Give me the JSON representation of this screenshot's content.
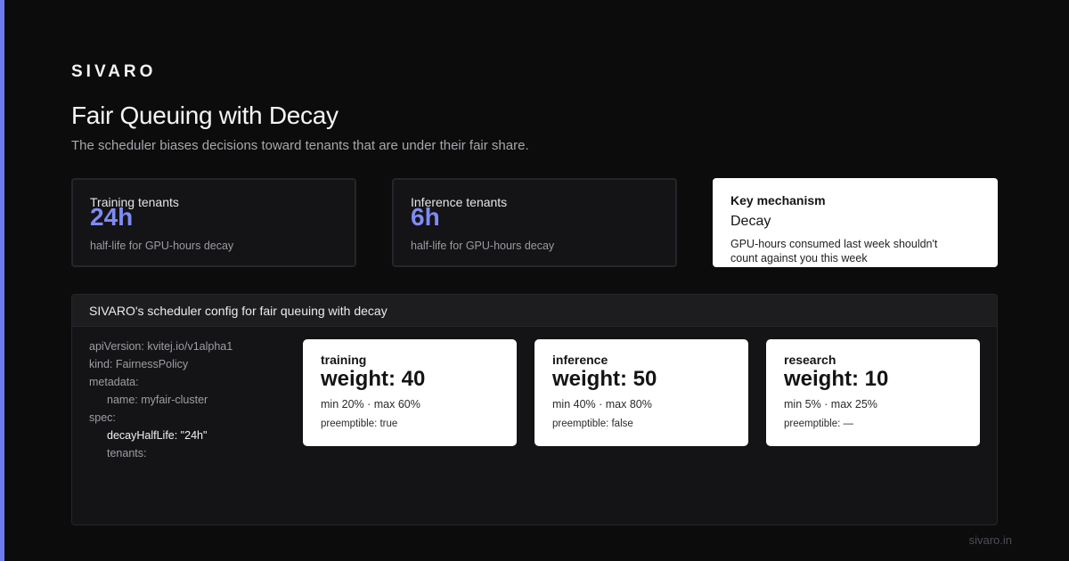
{
  "brand": "SIVARO",
  "title": "Fair Queuing with Decay",
  "subtitle": "The scheduler biases decisions toward tenants that are under their fair share.",
  "stats": [
    {
      "label": "Training tenants",
      "value": "24h",
      "caption": "half-life for GPU-hours decay"
    },
    {
      "label": "Inference tenants",
      "value": "6h",
      "caption": "half-life for GPU-hours decay"
    }
  ],
  "mechanism": {
    "label": "Key mechanism",
    "value": "Decay",
    "description": "GPU-hours consumed last week shouldn't count against you this week"
  },
  "config": {
    "header": "SIVARO's scheduler config for fair queuing with decay",
    "code_lines": [
      "apiVersion: kvitej.io/v1alpha1",
      "kind: FairnessPolicy",
      "metadata:",
      "name: myfair-cluster",
      "spec:",
      "decayHalfLife: \"24h\"",
      "tenants:"
    ],
    "tenants": [
      {
        "name": "training",
        "weight": "weight: 40",
        "limits": "min 20% · max 60%",
        "preemptible": "preemptible: true"
      },
      {
        "name": "inference",
        "weight": "weight: 50",
        "limits": "min 40% · max 80%",
        "preemptible": "preemptible: false"
      },
      {
        "name": "research",
        "weight": "weight: 10",
        "limits": "min 5% · max 25%",
        "preemptible": "preemptible: —"
      }
    ]
  },
  "footer": "sivaro.in",
  "colors": {
    "accent": "#6f7cf0",
    "stat_value": "#7f8bf3",
    "background": "#0c0c0d"
  }
}
